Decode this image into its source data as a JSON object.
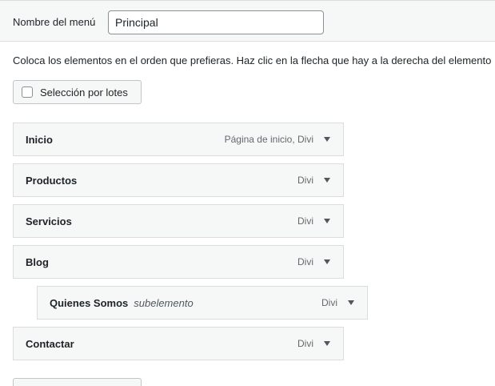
{
  "menu_name": {
    "label": "Nombre del menú",
    "value": "Principal"
  },
  "instructions": "Coloca los elementos en el orden que prefieras. Haz clic en la flecha que hay a la derecha del elemento",
  "bulk_select": {
    "label": "Selección por lotes",
    "checked": false
  },
  "menu_items": [
    {
      "title": "Inicio",
      "sub": "",
      "type": "Página de inicio, Divi"
    },
    {
      "title": "Productos",
      "sub": "",
      "type": "Divi"
    },
    {
      "title": "Servicios",
      "sub": "",
      "type": "Divi"
    },
    {
      "title": "Blog",
      "sub": "",
      "type": "Divi"
    },
    {
      "title": "Quienes Somos",
      "sub": "subelemento",
      "type": "Divi"
    },
    {
      "title": "Contactar",
      "sub": "",
      "type": "Divi"
    }
  ],
  "icons": {
    "toggle": "caret-down-icon",
    "checkbox": "checkbox-icon"
  },
  "colors": {
    "panel_bg": "#f6f7f7",
    "border": "#dcdcde",
    "text": "#1d2327",
    "muted": "#646970"
  }
}
